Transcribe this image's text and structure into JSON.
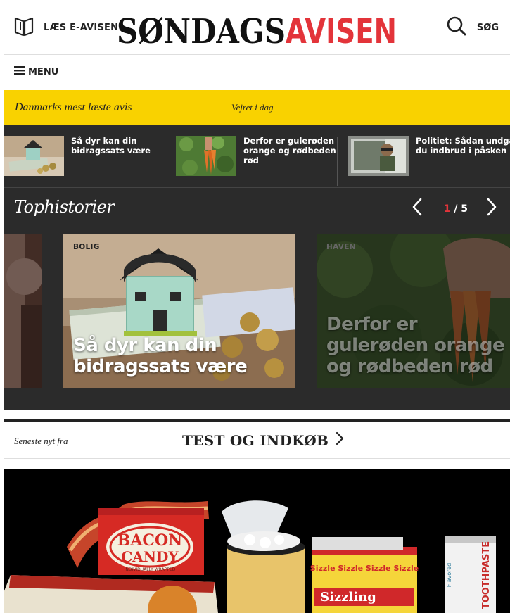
{
  "header": {
    "eavis_label": "LÆS E-AVISEN",
    "logo_part1": "SØNDAGS",
    "logo_part2": "AVISEN",
    "search_label": "SØG"
  },
  "menu": {
    "label": "MENU"
  },
  "bar": {
    "tagline": "Danmarks mest læste avis",
    "weather": "Vejret i dag"
  },
  "strip": [
    {
      "title": "Så dyr kan din bidragssats være"
    },
    {
      "title": "Derfor er gulerøden orange og rødbeden rød"
    },
    {
      "title": "Politiet: Sådan undgår du indbrud i påsken"
    }
  ],
  "top": {
    "title": "Tophistorier",
    "page_current": "1",
    "page_sep": " / ",
    "page_total": "5",
    "cards": [
      {
        "category": "BOLIG",
        "headline": "Så dyr kan din bidragssats være"
      },
      {
        "category": "HAVEN",
        "headline": "Derfor er gulerøden orange og rødbeden rød"
      }
    ]
  },
  "latest": {
    "prefix": "Seneste nyt fra",
    "section": "TEST OG INDKØB"
  },
  "hero": {
    "label_bacon": "BACON",
    "label_candy": "CANDY",
    "label_wrapped": "INDIVIDUALLY WRAPPED",
    "label_sizzle": "Sizzle Sizzle Sizzle Sizzle",
    "label_sizzling": "Sizzling",
    "label_toothpaste": "TOOTHPASTE",
    "label_flavored": "Flavored"
  },
  "colors": {
    "accent_red": "#e3343a",
    "bar_yellow": "#f9d200",
    "dark_panel": "#2b2b2b"
  }
}
